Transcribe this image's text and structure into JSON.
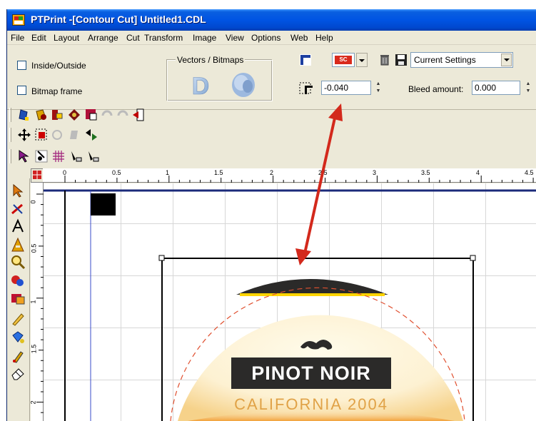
{
  "window": {
    "title": "PTPrint -[Contour Cut] Untitled1.CDL"
  },
  "menubar": {
    "items": [
      "File",
      "Edit",
      "Layout",
      "Arrange",
      "Cut",
      "Transform",
      "Image",
      "View",
      "Options",
      "Web",
      "Help"
    ]
  },
  "toppanel": {
    "inside_outside_label": "Inside/Outside",
    "bitmap_frame_label": "Bitmap frame",
    "vectors_bitmaps_label": "Vectors / Bitmaps",
    "vector_letter": "D",
    "color_swatch_text": "SC",
    "settings_value": "Current Settings",
    "offset_value": "-0.040",
    "bleed_label": "Bleed amount:",
    "bleed_value": "0.000"
  },
  "ruler": {
    "horizontal_labels": [
      "0",
      "0.5",
      "1",
      "1.5",
      "2",
      "2.5",
      "3",
      "3.5",
      "4",
      "4.5"
    ],
    "vertical_labels": [
      "0",
      "0.5",
      "1",
      "1.5",
      "2"
    ]
  },
  "label_artwork": {
    "wine_name": "PINOT NOIR",
    "region_year": "CALIFORNIA 2004"
  },
  "colors": {
    "titlebar": "#0054e3",
    "window_bg": "#ece9d8",
    "annotation_arrow": "#d3291c",
    "label_dark": "#2b2a29",
    "label_gold": "#e0a247",
    "label_cream": "#fdf1d2"
  },
  "icons": {
    "toolbar_1": [
      "blue-bucket-icon",
      "trace-icon",
      "shape-icon",
      "fill-icon",
      "node-icon",
      "undo-icon",
      "redo-icon",
      "exit-icon"
    ],
    "toolbar_2": [
      "move-icon",
      "select-box-icon",
      "rotate-icon",
      "skew-icon",
      "flip-icon"
    ],
    "toolbar_3": [
      "pointer-icon",
      "scissors-icon",
      "grid-icon",
      "pen-add-icon",
      "pen-remove-icon"
    ],
    "left_toolbox": [
      "arrow-icon",
      "cutter-icon",
      "text-icon",
      "art-text-icon",
      "zoom-icon",
      "shapes-icon",
      "color-icon",
      "pencil-icon",
      "fill-bucket-icon",
      "brush-icon",
      "eraser-icon"
    ]
  }
}
